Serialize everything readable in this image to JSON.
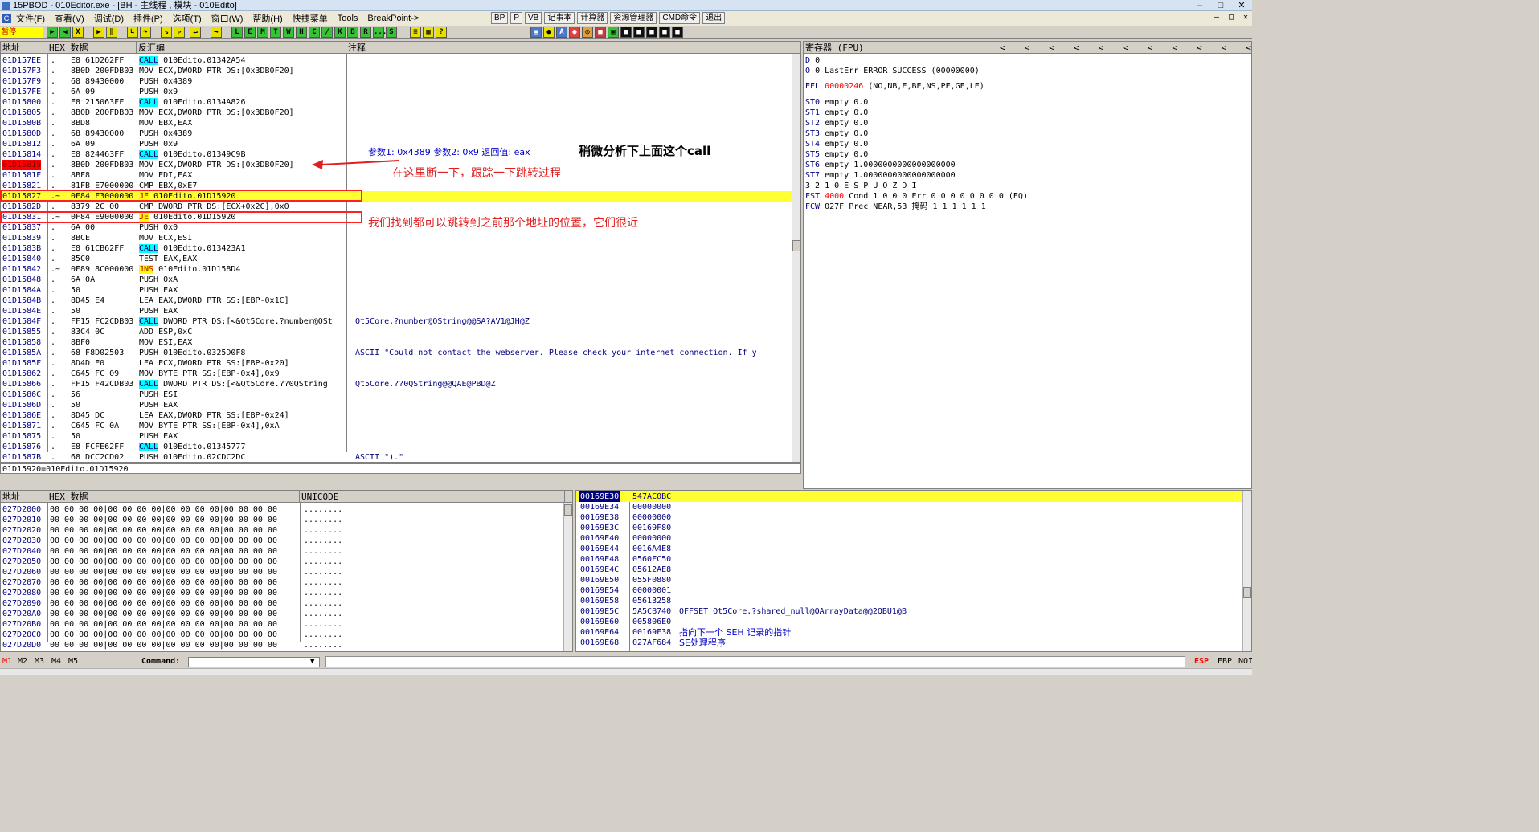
{
  "window": {
    "title": "15PBOD - 010Editor.exe - [BH - 主线程 , 模块 - 010Edito]"
  },
  "menu": {
    "items": [
      "文件(F)",
      "查看(V)",
      "调试(D)",
      "插件(P)",
      "选项(T)",
      "窗口(W)",
      "帮助(H)",
      "快捷菜单",
      "Tools",
      "BreakPoint->"
    ],
    "buttons": [
      "BP",
      "P",
      "VB",
      "记事本",
      "计算器",
      "资源管理器",
      "CMD命令",
      "退出"
    ]
  },
  "toolbar": {
    "status": "暂停",
    "buttons": [
      "",
      "",
      "X",
      "",
      "",
      "",
      "",
      "",
      "L",
      "E",
      "M",
      "T",
      "W",
      "H",
      "C",
      "/",
      "K",
      "B",
      "R",
      "...",
      "S",
      "",
      "?"
    ]
  },
  "cpu": {
    "headers": {
      "addr": "地址",
      "hex": "HEX 数据",
      "disasm": "反汇编",
      "comment": "注释"
    },
    "rows": [
      {
        "addr": "01D157EE",
        "mark": ".",
        "hex": "E8 61D262FF",
        "tag": "CALL",
        "dis": " 010Edito.01342A54",
        "com": ""
      },
      {
        "addr": "01D157F3",
        "mark": ".",
        "hex": "8B0D 200FDB03",
        "tag": "",
        "dis": "MOV ECX,DWORD PTR DS:[0x3DB0F20]",
        "com": ""
      },
      {
        "addr": "01D157F9",
        "mark": ".",
        "hex": "68 89430000",
        "tag": "",
        "dis": "PUSH 0x4389",
        "com": ""
      },
      {
        "addr": "01D157FE",
        "mark": ".",
        "hex": "6A 09",
        "tag": "",
        "dis": "PUSH 0x9",
        "com": ""
      },
      {
        "addr": "01D15800",
        "mark": ".",
        "hex": "E8 215063FF",
        "tag": "CALL",
        "dis": " 010Edito.0134A826",
        "com": ""
      },
      {
        "addr": "01D15805",
        "mark": ".",
        "hex": "8B0D 200FDB03",
        "tag": "",
        "dis": "MOV ECX,DWORD PTR DS:[0x3DB0F20]",
        "com": ""
      },
      {
        "addr": "01D1580B",
        "mark": ".",
        "hex": "8BD8",
        "tag": "",
        "dis": "MOV EBX,EAX",
        "com": ""
      },
      {
        "addr": "01D1580D",
        "mark": ".",
        "hex": "68 89430000",
        "tag": "",
        "dis": "PUSH 0x4389",
        "com": ""
      },
      {
        "addr": "01D15812",
        "mark": ".",
        "hex": "6A 09",
        "tag": "",
        "dis": "PUSH 0x9",
        "com": ""
      },
      {
        "addr": "01D15814",
        "mark": ".",
        "hex": "E8 824463FF",
        "tag": "CALL",
        "dis": " 010Edito.01349C9B",
        "com": ""
      },
      {
        "addr": "01D15819",
        "mark": ".",
        "hex": "8B0D 200FDB03",
        "tag": "",
        "dis": "MOV ECX,DWORD PTR DS:[0x3DB0F20]",
        "com": "",
        "red": true
      },
      {
        "addr": "01D1581F",
        "mark": ".",
        "hex": "8BF8",
        "tag": "",
        "dis": "MOV EDI,EAX",
        "com": ""
      },
      {
        "addr": "01D15821",
        "mark": ".",
        "hex": "81FB E7000000",
        "tag": "",
        "dis": "CMP EBX,0xE7",
        "com": ""
      },
      {
        "addr": "01D15827",
        "mark": ".~",
        "hex": "0F84 F3000000",
        "tag": "JE",
        "dis": " 010Edito.01D15920",
        "com": "",
        "hl": true
      },
      {
        "addr": "01D1582D",
        "mark": ".",
        "hex": "8379 2C 00",
        "tag": "",
        "dis": "CMP DWORD PTR DS:[ECX+0x2C],0x0",
        "com": ""
      },
      {
        "addr": "01D15831",
        "mark": ".~",
        "hex": "0F84 E9000000",
        "tag": "JE",
        "dis": " 010Edito.01D15920",
        "com": ""
      },
      {
        "addr": "01D15837",
        "mark": ".",
        "hex": "6A 00",
        "tag": "",
        "dis": "PUSH 0x0",
        "com": ""
      },
      {
        "addr": "01D15839",
        "mark": ".",
        "hex": "8BCE",
        "tag": "",
        "dis": "MOV ECX,ESI",
        "com": ""
      },
      {
        "addr": "01D1583B",
        "mark": ".",
        "hex": "E8 61CB62FF",
        "tag": "CALL",
        "dis": " 010Edito.013423A1",
        "com": ""
      },
      {
        "addr": "01D15840",
        "mark": ".",
        "hex": "85C0",
        "tag": "",
        "dis": "TEST EAX,EAX",
        "com": ""
      },
      {
        "addr": "01D15842",
        "mark": ".~",
        "hex": "0F89 8C000000",
        "tag": "JNS",
        "dis": " 010Edito.01D158D4",
        "com": ""
      },
      {
        "addr": "01D15848",
        "mark": ".",
        "hex": "6A 0A",
        "tag": "",
        "dis": "PUSH 0xA",
        "com": ""
      },
      {
        "addr": "01D1584A",
        "mark": ".",
        "hex": "50",
        "tag": "",
        "dis": "PUSH EAX",
        "com": ""
      },
      {
        "addr": "01D1584B",
        "mark": ".",
        "hex": "8D45 E4",
        "tag": "",
        "dis": "LEA EAX,DWORD PTR SS:[EBP-0x1C]",
        "com": ""
      },
      {
        "addr": "01D1584E",
        "mark": ".",
        "hex": "50",
        "tag": "",
        "dis": "PUSH EAX",
        "com": ""
      },
      {
        "addr": "01D1584F",
        "mark": ".",
        "hex": "FF15 FC2CDB03",
        "tag": "CALL",
        "dis": " DWORD PTR DS:[<&Qt5Core.?number@QSt",
        "com": "Qt5Core.?number@QString@@SA?AV1@JH@Z"
      },
      {
        "addr": "01D15855",
        "mark": ".",
        "hex": "83C4 0C",
        "tag": "",
        "dis": "ADD ESP,0xC",
        "com": ""
      },
      {
        "addr": "01D15858",
        "mark": ".",
        "hex": "8BF0",
        "tag": "",
        "dis": "MOV ESI,EAX",
        "com": ""
      },
      {
        "addr": "01D1585A",
        "mark": ".",
        "hex": "68 F8D02503",
        "tag": "",
        "dis": "PUSH 010Edito.0325D0F8",
        "com": "ASCII \"Could not contact the webserver. Please check your internet connection. If y"
      },
      {
        "addr": "01D1585F",
        "mark": ".",
        "hex": "8D4D E0",
        "tag": "",
        "dis": "LEA ECX,DWORD PTR SS:[EBP-0x20]",
        "com": ""
      },
      {
        "addr": "01D15862",
        "mark": ".",
        "hex": "C645 FC 09",
        "tag": "",
        "dis": "MOV BYTE PTR SS:[EBP-0x4],0x9",
        "com": ""
      },
      {
        "addr": "01D15866",
        "mark": ".",
        "hex": "FF15 F42CDB03",
        "tag": "CALL",
        "dis": " DWORD PTR DS:[<&Qt5Core.??0QString",
        "com": "Qt5Core.??0QString@@QAE@PBD@Z"
      },
      {
        "addr": "01D1586C",
        "mark": ".",
        "hex": "56",
        "tag": "",
        "dis": "PUSH ESI",
        "com": ""
      },
      {
        "addr": "01D1586D",
        "mark": ".",
        "hex": "50",
        "tag": "",
        "dis": "PUSH EAX",
        "com": ""
      },
      {
        "addr": "01D1586E",
        "mark": ".",
        "hex": "8D45 DC",
        "tag": "",
        "dis": "LEA EAX,DWORD PTR SS:[EBP-0x24]",
        "com": ""
      },
      {
        "addr": "01D15871",
        "mark": ".",
        "hex": "C645 FC 0A",
        "tag": "",
        "dis": "MOV BYTE PTR SS:[EBP-0x4],0xA",
        "com": ""
      },
      {
        "addr": "01D15875",
        "mark": ".",
        "hex": "50",
        "tag": "",
        "dis": "PUSH EAX",
        "com": ""
      },
      {
        "addr": "01D15876",
        "mark": ".",
        "hex": "E8 FCFE62FF",
        "tag": "CALL",
        "dis": " 010Edito.01345777",
        "com": ""
      },
      {
        "addr": "01D1587B",
        "mark": ".",
        "hex": "68 DCC2CD02",
        "tag": "",
        "dis": "PUSH 010Edito.02CDC2DC",
        "com": "ASCII \").\""
      }
    ],
    "info": "01D15920=010Edito.01D15920"
  },
  "annotations": {
    "params": "参数1: 0x4389  参数2: 0x9  返回值: eax",
    "analyze": "稍微分析下上面这个call",
    "breakhere": "在这里断一下，跟踪一下跳转过程",
    "found": "我们找到都可以跳转到之前那个地址的位置，它们很近"
  },
  "registers": {
    "header": "寄存器 (FPU)",
    "lines": [
      {
        "name": "D",
        "text": " 0",
        "red": ""
      },
      {
        "name": "O",
        "text": " 0  LastErr ERROR_SUCCESS (00000000)",
        "red": ""
      },
      {
        "name": "EFL",
        "text": " (NO,NB,E,BE,NS,PE,GE,LE)",
        "red": "00000246"
      },
      {
        "name": "ST0",
        "text": " empty 0.0",
        "red": ""
      },
      {
        "name": "ST1",
        "text": " empty 0.0",
        "red": ""
      },
      {
        "name": "ST2",
        "text": " empty 0.0",
        "red": ""
      },
      {
        "name": "ST3",
        "text": " empty 0.0",
        "red": ""
      },
      {
        "name": "ST4",
        "text": " empty 0.0",
        "red": ""
      },
      {
        "name": "ST5",
        "text": " empty 0.0",
        "red": ""
      },
      {
        "name": "ST6",
        "text": " empty 1.0000000000000000000",
        "red": ""
      },
      {
        "name": "ST7",
        "text": " empty 1.0000000000000000000",
        "red": ""
      },
      {
        "name": "",
        "text": "             3 2 1 0      E S P U O Z D I",
        "red": ""
      },
      {
        "name": "FST",
        "text": " Cond 1 0 0 0  Err 0 0 0 0 0 0 0 0  (EQ)",
        "red": "4000"
      },
      {
        "name": "FCW",
        "text": " 027F  Prec NEAR,53  掩码    1 1 1 1 1 1",
        "red": ""
      }
    ]
  },
  "dump": {
    "headers": {
      "addr": "地址",
      "hex": "HEX 数据",
      "unicode": "UNICODE"
    },
    "hexline": "00 00 00 00|00 00 00 00|00 00 00 00|00 00 00 00",
    "uni": "........",
    "addrs": [
      "027D2000",
      "027D2010",
      "027D2020",
      "027D2030",
      "027D2040",
      "027D2050",
      "027D2060",
      "027D2070",
      "027D2080",
      "027D2090",
      "027D20A0",
      "027D20B0",
      "027D20C0",
      "027D20D0"
    ]
  },
  "stack": {
    "rows": [
      {
        "addr": "00169E30",
        "val": "547AC0BC",
        "com": "",
        "zh": "",
        "top": true
      },
      {
        "addr": "00169E34",
        "val": "00000000",
        "com": "",
        "zh": ""
      },
      {
        "addr": "00169E38",
        "val": "00000000",
        "com": "",
        "zh": ""
      },
      {
        "addr": "00169E3C",
        "val": "00169F80",
        "com": "",
        "zh": ""
      },
      {
        "addr": "00169E40",
        "val": "00000000",
        "com": "",
        "zh": ""
      },
      {
        "addr": "00169E44",
        "val": "0016A4E8",
        "com": "",
        "zh": ""
      },
      {
        "addr": "00169E48",
        "val": "0560FC50",
        "com": "",
        "zh": ""
      },
      {
        "addr": "00169E4C",
        "val": "05612AE8",
        "com": "",
        "zh": ""
      },
      {
        "addr": "00169E50",
        "val": "055F0880",
        "com": "",
        "zh": ""
      },
      {
        "addr": "00169E54",
        "val": "00000001",
        "com": "",
        "zh": ""
      },
      {
        "addr": "00169E58",
        "val": "05613258",
        "com": "",
        "zh": ""
      },
      {
        "addr": "00169E5C",
        "val": "5A5CB740",
        "com": "OFFSET Qt5Core.?shared_null@QArrayData@@2QBU1@B",
        "zh": ""
      },
      {
        "addr": "00169E60",
        "val": "005806E0",
        "com": "",
        "zh": ""
      },
      {
        "addr": "00169E64",
        "val": "00169F38",
        "com": "",
        "zh": "指向下一个 SEH 记录的指针"
      },
      {
        "addr": "00169E68",
        "val": "027AF684",
        "com": "",
        "zh": "SE处理程序"
      }
    ]
  },
  "command": {
    "tabs": [
      "M1",
      "M2",
      "M3",
      "M4",
      "M5"
    ],
    "label": "Command:",
    "regs": [
      "ESP",
      "EBP",
      "NOI"
    ]
  }
}
